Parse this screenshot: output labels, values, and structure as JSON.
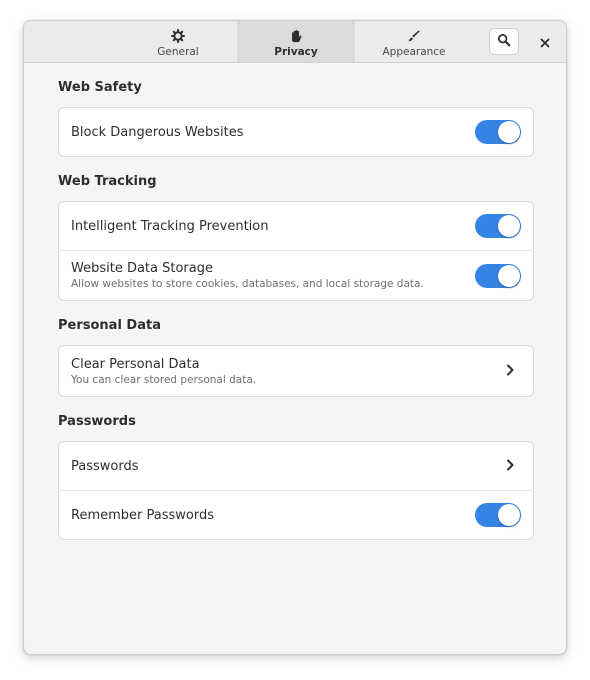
{
  "tabs": [
    {
      "label": "General",
      "icon": "gear-icon"
    },
    {
      "label": "Privacy",
      "icon": "hand-icon",
      "active": true
    },
    {
      "label": "Appearance",
      "icon": "brush-icon"
    }
  ],
  "header": {
    "search_icon": "search-icon",
    "close_icon": "close-icon"
  },
  "sections": {
    "web_safety": {
      "title": "Web Safety",
      "rows": [
        {
          "label": "Block Dangerous Websites",
          "enabled": true
        }
      ]
    },
    "web_tracking": {
      "title": "Web Tracking",
      "rows": [
        {
          "label": "Intelligent Tracking Prevention",
          "enabled": true
        },
        {
          "label": "Website Data Storage",
          "subtitle": "Allow websites to store cookies, databases, and local storage data.",
          "enabled": true
        }
      ]
    },
    "personal_data": {
      "title": "Personal Data",
      "rows": [
        {
          "label": "Clear Personal Data",
          "subtitle": "You can clear stored personal data."
        }
      ]
    },
    "passwords": {
      "title": "Passwords",
      "rows": [
        {
          "label": "Passwords"
        },
        {
          "label": "Remember Passwords",
          "enabled": true
        }
      ]
    }
  },
  "colors": {
    "accent": "#3584e4",
    "window_bg": "#f6f5f4",
    "header_bg": "#ebebea"
  }
}
